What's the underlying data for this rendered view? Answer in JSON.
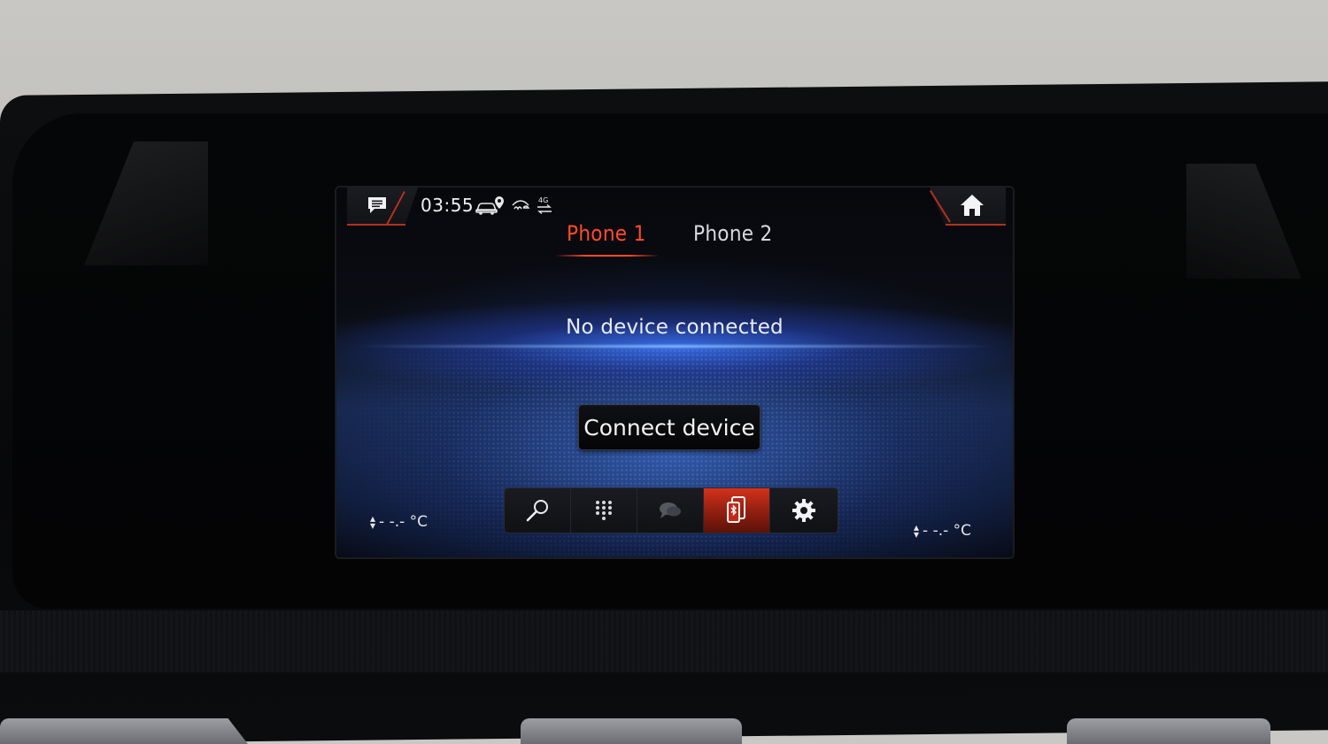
{
  "status_bar": {
    "time": "03:55",
    "icons": [
      "message-icon",
      "car-location-icon",
      "mercedes-me-icon",
      "4g-signal-icon"
    ],
    "network_label": "4G"
  },
  "tabs": [
    {
      "label": "Phone 1",
      "active": true
    },
    {
      "label": "Phone 2",
      "active": false
    }
  ],
  "main": {
    "message": "No device connected",
    "connect_button": "Connect device"
  },
  "dock": {
    "items": [
      {
        "icon": "search-icon",
        "active": false
      },
      {
        "icon": "keypad-icon",
        "active": false
      },
      {
        "icon": "messages-icon",
        "active": false
      },
      {
        "icon": "bluetooth-phone-icon",
        "active": true
      },
      {
        "icon": "settings-gear-icon",
        "active": false
      }
    ]
  },
  "climate": {
    "left_temp": "- -.- °C",
    "right_temp": "- -.- °C"
  },
  "colors": {
    "accent_red": "#ff4b2b",
    "ambient_blue": "#3c78ff"
  }
}
